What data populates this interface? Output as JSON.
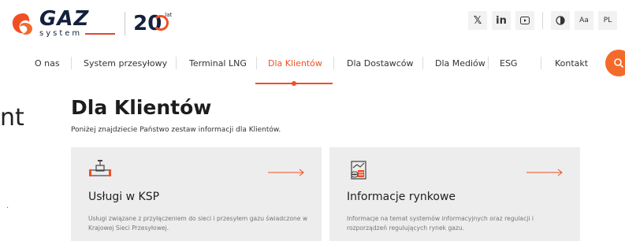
{
  "brand": {
    "logo_word": "GAZ",
    "logo_sub": "system",
    "anniversary_number": "20",
    "anniversary_suffix": "lat",
    "accent_color": "#f04f23"
  },
  "utility": {
    "social": [
      {
        "icon": "x-twitter-icon",
        "glyph": "𝕏"
      },
      {
        "icon": "linkedin-icon",
        "glyph": "in"
      },
      {
        "icon": "youtube-icon",
        "glyph": "▷"
      }
    ],
    "contrast_icon": "contrast-icon",
    "font_size_label": "Aa",
    "language_label": "PL"
  },
  "nav": {
    "items": [
      {
        "label": "O nas",
        "active": false
      },
      {
        "label": "System przesyłowy",
        "active": false
      },
      {
        "label": "Terminal LNG",
        "active": false
      },
      {
        "label": "Dla Klientów",
        "active": true
      },
      {
        "label": "Dla Dostawców",
        "active": false
      },
      {
        "label": "Dla Mediów",
        "active": false
      },
      {
        "label": "ESG",
        "active": false
      },
      {
        "label": "Kontakt",
        "active": false
      }
    ],
    "search_icon": "search-icon"
  },
  "edge": {
    "text": "nt",
    "mark": "."
  },
  "main": {
    "title": "Dla Klientów",
    "subtitle": "Poniżej znajdziecie Państwo zestaw informacji dla Klientów.",
    "cards": [
      {
        "icon": "pipeline-valve-icon",
        "title": "Usługi w KSP",
        "description": "Usługi związane z przyłączeniem do sieci i przesyłem gazu świadczone w Krajowej Sieci Przesyłowej."
      },
      {
        "icon": "market-data-icon",
        "title": "Informacje rynkowe",
        "description": "Informacje na temat systemów informacyjnych oraz regulacji i rozporządzeń regulujących rynek gazu."
      }
    ]
  }
}
